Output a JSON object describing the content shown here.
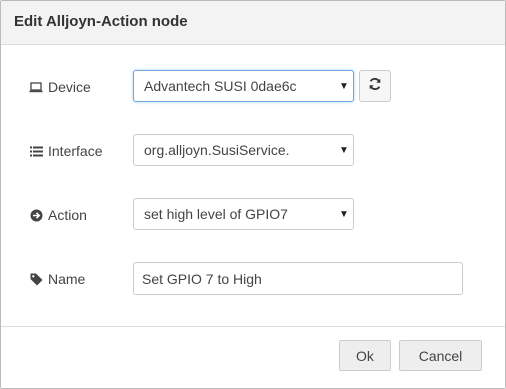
{
  "dialog": {
    "title": "Edit Alljoyn-Action node"
  },
  "fields": {
    "device": {
      "label": "Device",
      "icon": "laptop-icon",
      "value": "Advantech SUSI 0dae6c"
    },
    "interface": {
      "label": "Interface",
      "icon": "list-icon",
      "value": "org.alljoyn.SusiService."
    },
    "action": {
      "label": "Action",
      "icon": "circle-arrow-right-icon",
      "value": "set high level of GPIO7"
    },
    "name": {
      "label": "Name",
      "icon": "tag-icon",
      "value": "Set GPIO 7 to High"
    }
  },
  "buttons": {
    "ok": "Ok",
    "cancel": "Cancel",
    "refresh_icon": "refresh-icon"
  },
  "colors": {
    "focus_border": "#6ea6d9",
    "title_bg": "#f3f3f3"
  }
}
